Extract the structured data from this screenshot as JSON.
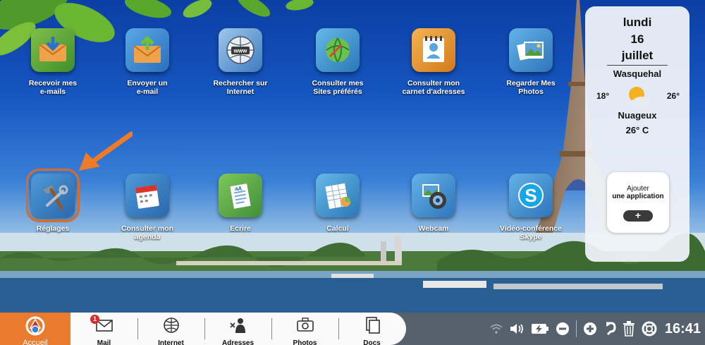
{
  "apps": [
    {
      "id": "recevoir",
      "label": "Recevoir mes\ne-mails",
      "icon": "receive-mail-icon"
    },
    {
      "id": "envoyer",
      "label": "Envoyer un\ne-mail",
      "icon": "send-mail-icon"
    },
    {
      "id": "rechercher",
      "label": "Rechercher sur\nInternet",
      "icon": "www-globe-icon"
    },
    {
      "id": "sites",
      "label": "Consulter mes\nSites préférés",
      "icon": "favorite-sites-icon"
    },
    {
      "id": "carnet",
      "label": "Consulter mon\ncarnet d'adresses",
      "icon": "address-book-icon"
    },
    {
      "id": "photos",
      "label": "Regarder Mes\nPhotos",
      "icon": "photos-icon"
    },
    {
      "id": "reglages",
      "label": "Réglages",
      "icon": "settings-tools-icon",
      "selected": true
    },
    {
      "id": "agenda",
      "label": "Consulter mon\nagenda",
      "icon": "calendar-icon"
    },
    {
      "id": "ecrire",
      "label": "Ecrire",
      "icon": "document-write-icon"
    },
    {
      "id": "calcul",
      "label": "Calcul",
      "icon": "spreadsheet-icon"
    },
    {
      "id": "webcam",
      "label": "Webcam",
      "icon": "webcam-icon"
    },
    {
      "id": "skype",
      "label": "Vidéo-conférence\nSkype",
      "icon": "skype-icon"
    }
  ],
  "weather": {
    "day": "lundi",
    "date": "16",
    "month": "juillet",
    "city": "Wasquehal",
    "min": "18°",
    "max": "26°",
    "condition": "Nuageux",
    "current": "26° C",
    "icon": "sun-cloud-icon"
  },
  "add_app": {
    "line1": "Ajouter",
    "line2": "une application",
    "button": "+"
  },
  "taskbar": {
    "home_label": "Accueil",
    "dock": [
      {
        "id": "mail",
        "label": "Mail",
        "icon": "mail-icon",
        "badge": "1"
      },
      {
        "id": "internet",
        "label": "Internet",
        "icon": "globe-icon"
      },
      {
        "id": "adresses",
        "label": "Adresses",
        "icon": "contacts-icon"
      },
      {
        "id": "photos",
        "label": "Photos",
        "icon": "camera-icon"
      },
      {
        "id": "docs",
        "label": "Docs",
        "icon": "documents-icon"
      }
    ],
    "clock": "16:41"
  },
  "colors": {
    "accent": "#ea7a2e",
    "taskbar": "#55616d",
    "selection": "#d86a2a"
  }
}
